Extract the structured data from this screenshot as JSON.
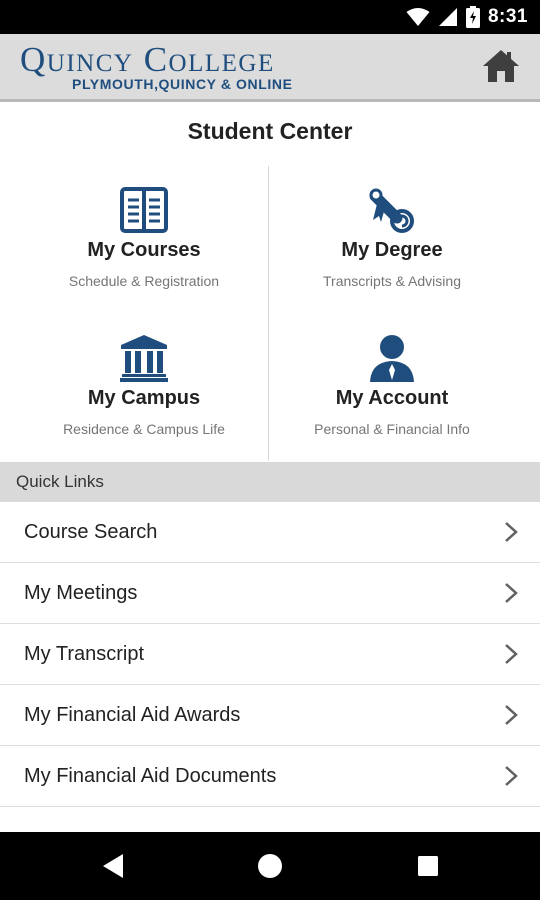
{
  "status_bar": {
    "time": "8:31",
    "icons": [
      "wifi-icon",
      "cell-signal-icon",
      "battery-charging-icon"
    ]
  },
  "header": {
    "logo_title": "Quincy College",
    "logo_subtitle": "PLYMOUTH,QUINCY & ONLINE",
    "home_icon": "home-icon",
    "brand_color": "#1f4e7e"
  },
  "student_center": {
    "title": "Student Center",
    "tiles": [
      {
        "title": "My Courses",
        "subtitle": "Schedule & Registration",
        "icon": "book-icon"
      },
      {
        "title": "My Degree",
        "subtitle": "Transcripts & Advising",
        "icon": "diploma-icon"
      },
      {
        "title": "My Campus",
        "subtitle": "Residence & Campus Life",
        "icon": "building-icon"
      },
      {
        "title": "My Account",
        "subtitle": "Personal & Financial Info",
        "icon": "user-icon"
      }
    ]
  },
  "quick_links": {
    "header": "Quick Links",
    "items": [
      {
        "label": "Course Search"
      },
      {
        "label": "My Meetings"
      },
      {
        "label": "My Transcript"
      },
      {
        "label": "My Financial Aid Awards"
      },
      {
        "label": "My Financial Aid Documents"
      }
    ]
  },
  "nav_bar": {
    "icons": [
      "back-icon",
      "home-circle-icon",
      "recents-icon"
    ]
  }
}
